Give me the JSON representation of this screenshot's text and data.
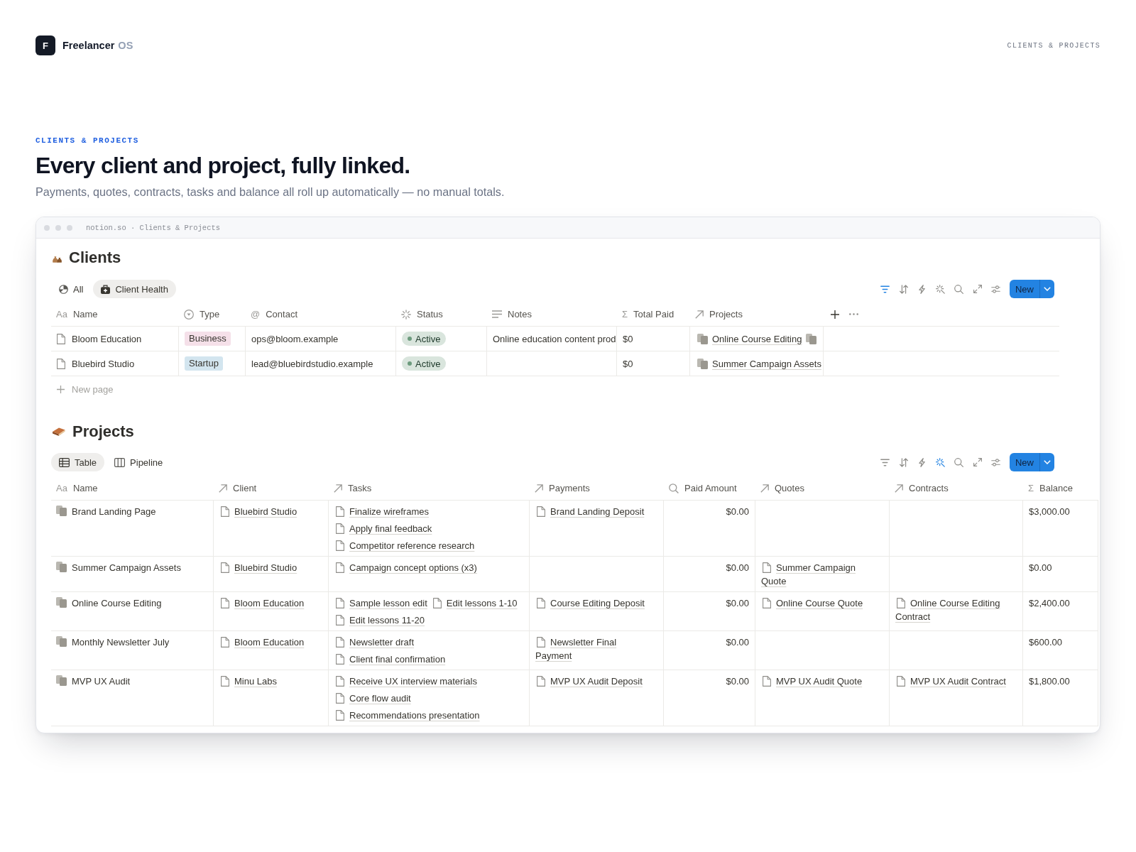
{
  "brand": {
    "logo_letter": "F",
    "name": "Freelancer",
    "suffix": "OS"
  },
  "nav_label": "CLIENTS & PROJECTS",
  "hero": {
    "eyebrow": "CLIENTS & PROJECTS",
    "title": "Every client and project, fully linked.",
    "subtitle": "Payments, quotes, contracts, tasks and balance all roll up automatically — no manual totals."
  },
  "browser": {
    "address": "notion.so · Clients & Projects"
  },
  "databases": [
    {
      "kind": "clients",
      "title": "Clients",
      "views": [
        {
          "label": "All",
          "kind": "all",
          "selected": false
        },
        {
          "label": "Client Health",
          "kind": "health",
          "selected": true
        }
      ],
      "tools": [
        {
          "kind": "filter",
          "active": true
        },
        {
          "kind": "sort",
          "active": false
        },
        {
          "kind": "lightning",
          "active": false
        },
        {
          "kind": "sparkle",
          "active": false
        },
        {
          "kind": "search",
          "active": false
        },
        {
          "kind": "expand",
          "active": false
        },
        {
          "kind": "settings",
          "active": false
        }
      ],
      "new_button": "New",
      "columns": [
        {
          "label": "Name",
          "kind": "title",
          "glyph": "Aa"
        },
        {
          "label": "Type",
          "kind": "select"
        },
        {
          "label": "Contact",
          "kind": "email",
          "glyph": "@"
        },
        {
          "label": "Status",
          "kind": "status"
        },
        {
          "label": "Notes",
          "kind": "text"
        },
        {
          "label": "Total Paid",
          "kind": "formula",
          "glyph": "Σ"
        },
        {
          "label": "Projects",
          "kind": "relation"
        }
      ],
      "column_actions": true,
      "rows": [
        {
          "cells": [
            {
              "text": "Bloom Education",
              "kind": "page"
            },
            {
              "text": "Business",
              "color": "#f5e0e9"
            },
            "ops@bloom.example",
            {
              "text": "Active",
              "color": "#6c9b7d"
            },
            "Online education content prod",
            "$0",
            {
              "kind": "project",
              "items": [
                "Online Course Editing"
              ],
              "overflow": true
            }
          ]
        },
        {
          "cells": [
            {
              "text": "Bluebird Studio",
              "kind": "page"
            },
            {
              "text": "Startup",
              "color": "#d3e5ef"
            },
            "lead@bluebirdstudio.example",
            {
              "text": "Active",
              "color": "#6c9b7d"
            },
            null,
            "$0",
            {
              "kind": "project",
              "items": [
                "Summer Campaign Assets"
              ],
              "overflow": false
            }
          ]
        }
      ],
      "new_page": "New page"
    },
    {
      "kind": "projects",
      "title": "Projects",
      "views": [
        {
          "label": "Table",
          "kind": "table",
          "selected": true
        },
        {
          "label": "Pipeline",
          "kind": "board",
          "selected": false
        }
      ],
      "tools": [
        {
          "kind": "filter",
          "active": false
        },
        {
          "kind": "sort",
          "active": false
        },
        {
          "kind": "lightning",
          "active": false
        },
        {
          "kind": "sparkle",
          "active": true
        },
        {
          "kind": "search",
          "active": false
        },
        {
          "kind": "expand",
          "active": false
        },
        {
          "kind": "settings",
          "active": false
        }
      ],
      "new_button": "New",
      "columns": [
        {
          "label": "Name",
          "kind": "title",
          "glyph": "Aa"
        },
        {
          "label": "Client",
          "kind": "relation"
        },
        {
          "label": "Tasks",
          "kind": "relation"
        },
        {
          "label": "Payments",
          "kind": "relation"
        },
        {
          "label": "Paid Amount",
          "kind": "rollup"
        },
        {
          "label": "Quotes",
          "kind": "relation"
        },
        {
          "label": "Contracts",
          "kind": "relation"
        },
        {
          "label": "Balance",
          "kind": "formula",
          "glyph": "Σ"
        }
      ],
      "rows": [
        {
          "cells": [
            {
              "text": "Brand Landing Page",
              "kind": "project"
            },
            {
              "kind": "page",
              "items": [
                "Bluebird Studio"
              ]
            },
            {
              "kind": "page",
              "items": [
                "Finalize wireframes",
                "Apply final feedback",
                "Competitor reference research"
              ]
            },
            {
              "kind": "page",
              "items": [
                "Brand Landing Deposit"
              ]
            },
            "$0.00",
            null,
            null,
            "$3,000.00"
          ]
        },
        {
          "cells": [
            {
              "text": "Summer Campaign Assets",
              "kind": "project"
            },
            {
              "kind": "page",
              "items": [
                "Bluebird Studio"
              ]
            },
            {
              "kind": "page",
              "items": [
                "Campaign concept options (x3)"
              ]
            },
            null,
            "$0.00",
            {
              "kind": "page",
              "items": [
                "Summer Campaign Quote"
              ]
            },
            null,
            "$0.00"
          ]
        },
        {
          "cells": [
            {
              "text": "Online Course Editing",
              "kind": "project"
            },
            {
              "kind": "page",
              "items": [
                "Bloom Education"
              ]
            },
            {
              "kind": "page",
              "items": [
                "Sample lesson edit",
                "Edit lessons 1-10",
                "Edit lessons 11-20"
              ]
            },
            {
              "kind": "page",
              "items": [
                "Course Editing Deposit"
              ]
            },
            "$0.00",
            {
              "kind": "page",
              "items": [
                "Online Course Quote"
              ]
            },
            {
              "kind": "page",
              "items": [
                "Online Course Editing Contract"
              ]
            },
            "$2,400.00"
          ]
        },
        {
          "cells": [
            {
              "text": "Monthly Newsletter July",
              "kind": "project"
            },
            {
              "kind": "page",
              "items": [
                "Bloom Education"
              ]
            },
            {
              "kind": "page",
              "items": [
                "Newsletter draft",
                "Client final confirmation"
              ]
            },
            {
              "kind": "page",
              "items": [
                "Newsletter Final Payment"
              ]
            },
            "$0.00",
            null,
            null,
            "$600.00"
          ]
        },
        {
          "cells": [
            {
              "text": "MVP UX Audit",
              "kind": "project"
            },
            {
              "kind": "page",
              "items": [
                "Minu Labs"
              ]
            },
            {
              "kind": "page",
              "items": [
                "Receive UX interview materials",
                "Core flow audit",
                "Recommendations presentation"
              ]
            },
            {
              "kind": "page",
              "items": [
                "MVP UX Audit Deposit"
              ]
            },
            "$0.00",
            {
              "kind": "page",
              "items": [
                "MVP UX Audit Quote"
              ]
            },
            {
              "kind": "page",
              "items": [
                "MVP UX Audit Contract"
              ]
            },
            "$1,800.00"
          ]
        }
      ]
    }
  ]
}
